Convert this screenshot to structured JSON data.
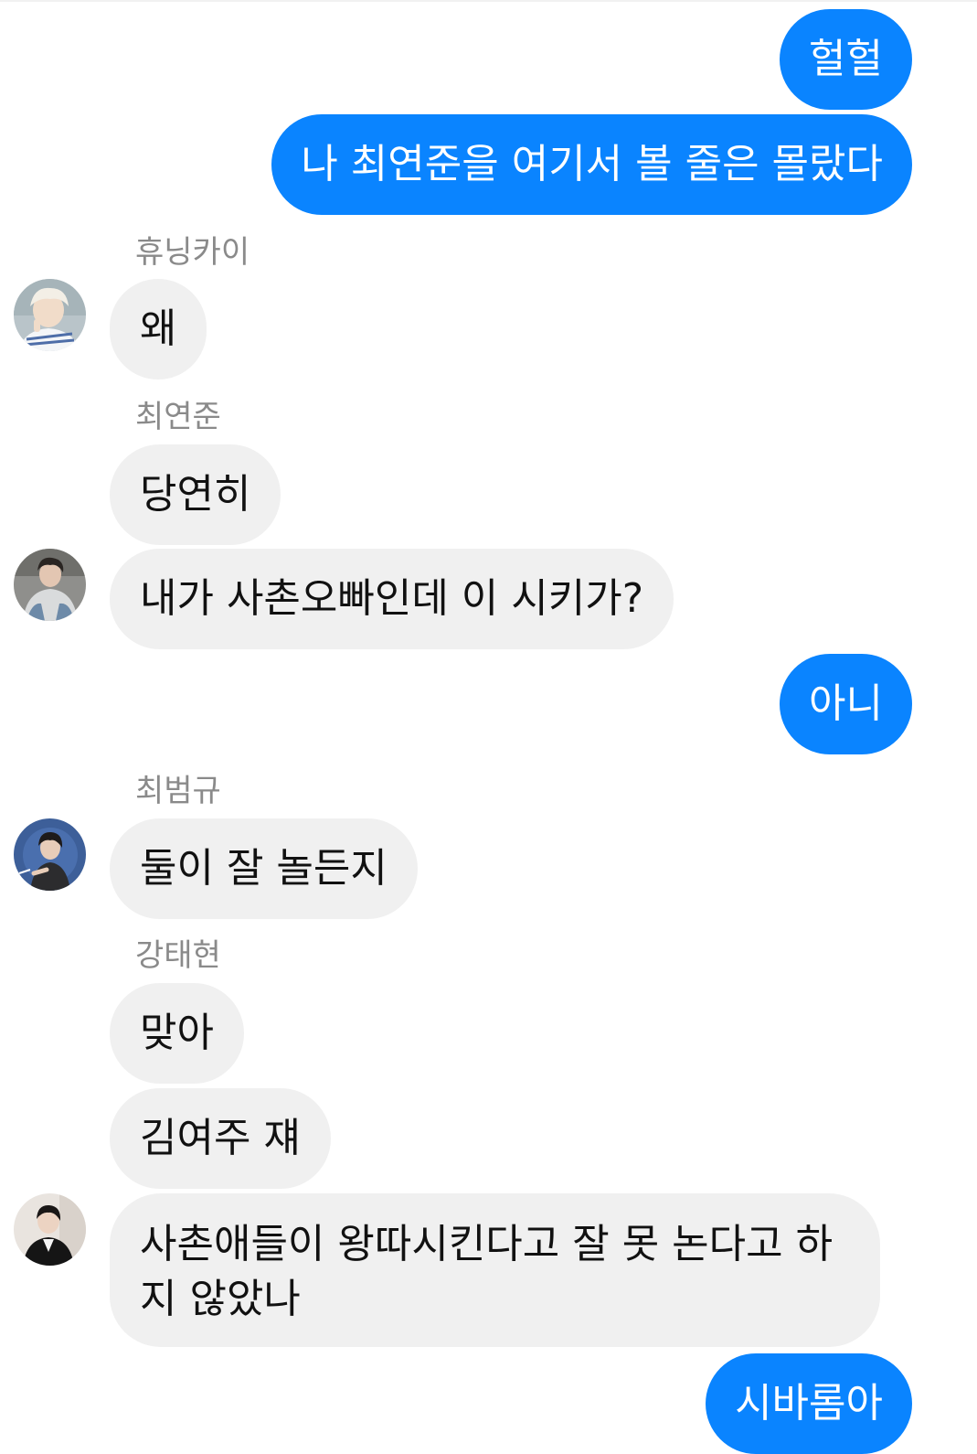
{
  "conversation": {
    "messages": [
      {
        "sender": "",
        "direction": "outgoing",
        "text": "헐헐"
      },
      {
        "sender": "",
        "direction": "outgoing",
        "text": "나 최연준을 여기서 볼 줄은 몰랐다"
      },
      {
        "sender": "휴닝카이",
        "direction": "incoming",
        "text": "왜"
      },
      {
        "sender": "최연준",
        "direction": "incoming",
        "text": "당연히"
      },
      {
        "sender": "최연준",
        "direction": "incoming",
        "text": "내가 사촌오빠인데 이 시키가?"
      },
      {
        "sender": "",
        "direction": "outgoing",
        "text": "아니"
      },
      {
        "sender": "최범규",
        "direction": "incoming",
        "text": "둘이 잘 놀든지"
      },
      {
        "sender": "강태현",
        "direction": "incoming",
        "text": "맞아"
      },
      {
        "sender": "강태현",
        "direction": "incoming",
        "text": "김여주 쟤"
      },
      {
        "sender": "강태현",
        "direction": "incoming",
        "text": "사촌애들이 왕따시킨다고 잘 못 논다고 하지 않았나"
      },
      {
        "sender": "",
        "direction": "outgoing",
        "text": "시바롬아"
      }
    ],
    "senders": {
      "hueningkai": "휴닝카이",
      "yeonjun": "최연준",
      "beomgyu": "최범규",
      "taehyun": "강태현"
    },
    "avatars": {
      "hueningkai": "avatar-photo-blond",
      "yeonjun": "avatar-photo-dark-hair",
      "beomgyu": "avatar-photo-blue-bg",
      "taehyun": "avatar-photo-suit"
    }
  },
  "colors": {
    "outgoing_bubble": "#0a84ff",
    "outgoing_text": "#ffffff",
    "incoming_bubble": "#f0f0f0",
    "incoming_text": "#111111",
    "sender_name": "#8a8a8a",
    "background": "#ffffff"
  }
}
